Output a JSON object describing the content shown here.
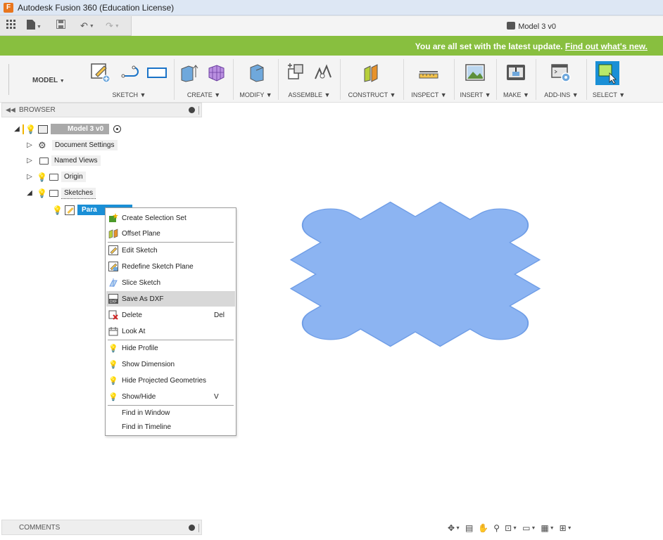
{
  "window": {
    "title": "Autodesk Fusion 360 (Education License)",
    "app_icon": "F"
  },
  "quick_access": {
    "document_tab": "Model 3 v0"
  },
  "banner": {
    "text": "You are all set with the latest update.",
    "link": "Find out what's new.",
    "color": "#88bf3f"
  },
  "ribbon": {
    "workspace": "MODEL",
    "groups": {
      "sketch": "SKETCH",
      "create": "CREATE",
      "modify": "MODIFY",
      "assemble": "ASSEMBLE",
      "construct": "CONSTRUCT",
      "inspect": "INSPECT",
      "insert": "INSERT",
      "make": "MAKE",
      "addins": "ADD-INS",
      "select": "SELECT"
    }
  },
  "browser": {
    "title": "BROWSER",
    "root": "Model 3 v0",
    "items": {
      "document_settings": "Document Settings",
      "named_views": "Named Views",
      "origin": "Origin",
      "sketches": "Sketches",
      "selected_sketch": "Para"
    }
  },
  "context_menu": {
    "items": [
      {
        "label": "Create Selection Set",
        "icon": "selection-set-icon"
      },
      {
        "label": "Offset Plane",
        "icon": "offset-plane-icon"
      },
      {
        "label": "Edit Sketch",
        "icon": "edit-sketch-icon"
      },
      {
        "label": "Redefine Sketch Plane",
        "icon": "redefine-plane-icon"
      },
      {
        "label": "Slice Sketch",
        "icon": "slice-icon"
      },
      {
        "label": "Save As DXF",
        "icon": "dxf-icon",
        "highlighted": true
      },
      {
        "label": "Delete",
        "shortcut": "Del",
        "icon": "delete-icon"
      },
      {
        "label": "Look At",
        "icon": "look-at-icon"
      },
      {
        "label": "Hide Profile",
        "icon": "lightbulb-icon"
      },
      {
        "label": "Show Dimension",
        "icon": "lightbulb-icon"
      },
      {
        "label": "Hide Projected Geometries",
        "icon": "lightbulb-icon"
      },
      {
        "label": "Show/Hide",
        "shortcut": "V",
        "icon": "lightbulb-icon"
      },
      {
        "label": "Find in Window"
      },
      {
        "label": "Find in Timeline"
      }
    ]
  },
  "comments": {
    "title": "COMMENTS"
  },
  "colors": {
    "sketch_fill": "#8cb4f2",
    "sketch_edge": "#6f9de6",
    "selection_blue": "#1a8fd6",
    "menu_highlight": "#d8d8d8"
  }
}
